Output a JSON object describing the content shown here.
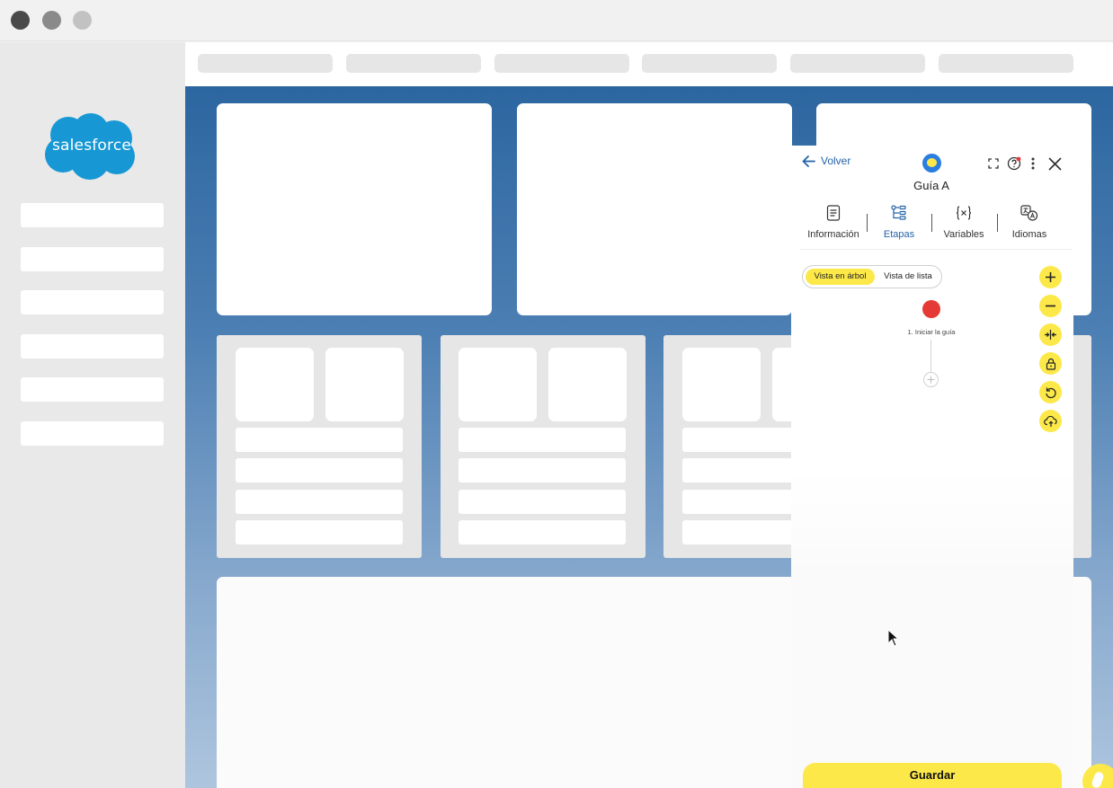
{
  "window": {
    "controls": [
      "close",
      "minimize",
      "maximize"
    ]
  },
  "sidebar": {
    "logo_text": "salesforce",
    "logo_color": "#1798d5"
  },
  "guide_panel": {
    "back_label": "Volver",
    "title": "Guía A",
    "header_icons": [
      "expand-icon",
      "help-icon",
      "more-vert-icon",
      "close-icon"
    ],
    "tabs": [
      {
        "label": "Información",
        "icon": "document-icon",
        "active": false
      },
      {
        "label": "Etapas",
        "icon": "tree-icon",
        "active": true
      },
      {
        "label": "Variables",
        "icon": "variables-icon",
        "active": false
      },
      {
        "label": "Idiomas",
        "icon": "languages-icon",
        "active": false
      }
    ],
    "view_toggle": {
      "selected": "Vista en árbol",
      "tree_label": "Vista en árbol",
      "list_label": "Vista de lista"
    },
    "tools": [
      "zoom-in-icon",
      "zoom-out-icon",
      "collapse-icon",
      "lock-icon",
      "undo-icon",
      "cloud-upload-icon"
    ],
    "steps": [
      {
        "label": "1. Iniciar la guía",
        "status_color": "#e53935"
      }
    ],
    "save_label": "Guardar",
    "accent_color": "#fde84a",
    "link_color": "#2563a8"
  }
}
